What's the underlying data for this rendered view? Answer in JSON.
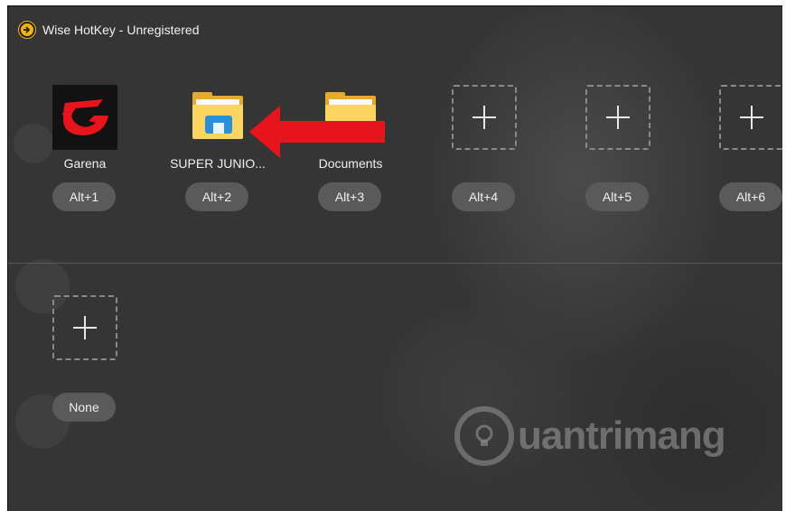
{
  "window": {
    "title": "Wise HotKey - Unregistered",
    "app_icon": "wise-hotkey-arrow-icon"
  },
  "slots": [
    {
      "name": "Garena",
      "hotkey": "Alt+1",
      "icon": "garena-icon"
    },
    {
      "name": "SUPER JUNIO...",
      "hotkey": "Alt+2",
      "icon": "folder-icon"
    },
    {
      "name": "Documents",
      "hotkey": "Alt+3",
      "icon": "folder-icon"
    },
    {
      "name": "",
      "hotkey": "Alt+4",
      "icon": "plus-icon"
    },
    {
      "name": "",
      "hotkey": "Alt+5",
      "icon": "plus-icon"
    },
    {
      "name": "",
      "hotkey": "Alt+6",
      "icon": "plus-icon"
    }
  ],
  "second_row": [
    {
      "name": "",
      "hotkey": "None",
      "icon": "plus-icon"
    }
  ],
  "annotation": {
    "arrow_color": "#e8141b"
  },
  "watermark": {
    "text": "uantrimang"
  },
  "colors": {
    "background": "#353535",
    "hotkey_pill": "#5a5a5a",
    "title_icon": "#f2b705",
    "garena_red": "#e8141b"
  }
}
